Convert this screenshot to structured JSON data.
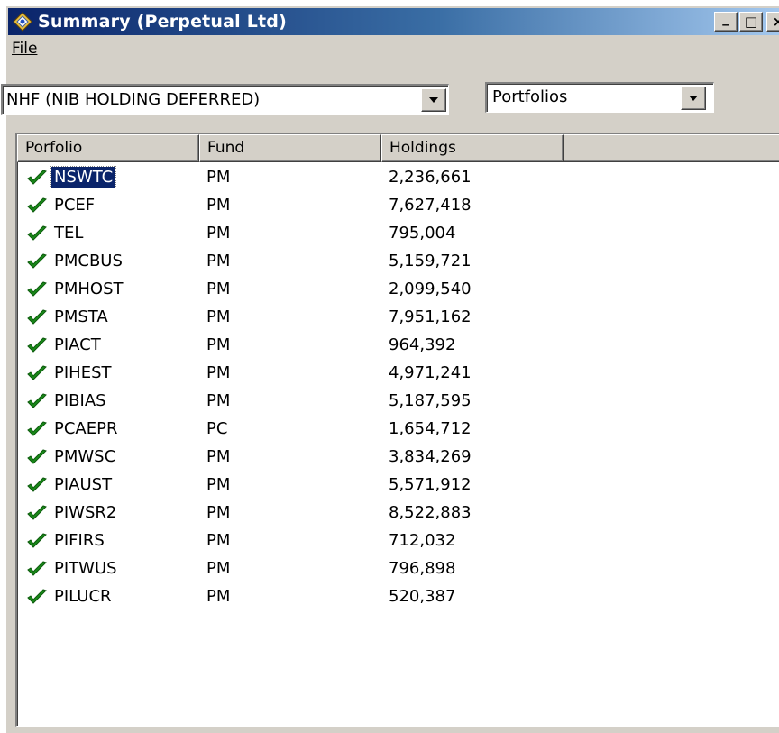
{
  "window": {
    "title": "Summary (Perpetual Ltd)",
    "buttons": {
      "minimize": "_",
      "maximize": "□",
      "close": "×"
    }
  },
  "menu": {
    "file": "File"
  },
  "toolbar": {
    "fund_select": "NHF (NIB HOLDING DEFERRED)",
    "view_select": "Portfolios"
  },
  "table": {
    "columns": [
      "Porfolio",
      "Fund",
      "Holdings",
      ""
    ],
    "rows": [
      {
        "portfolio": "NSWTC",
        "fund": "PM",
        "holdings": "2,236,661",
        "selected": true
      },
      {
        "portfolio": "PCEF",
        "fund": "PM",
        "holdings": "7,627,418"
      },
      {
        "portfolio": "TEL",
        "fund": "PM",
        "holdings": "795,004"
      },
      {
        "portfolio": "PMCBUS",
        "fund": "PM",
        "holdings": "5,159,721"
      },
      {
        "portfolio": "PMHOST",
        "fund": "PM",
        "holdings": "2,099,540"
      },
      {
        "portfolio": "PMSTA",
        "fund": "PM",
        "holdings": "7,951,162"
      },
      {
        "portfolio": "PIACT",
        "fund": "PM",
        "holdings": "964,392"
      },
      {
        "portfolio": "PIHEST",
        "fund": "PM",
        "holdings": "4,971,241"
      },
      {
        "portfolio": "PIBIAS",
        "fund": "PM",
        "holdings": "5,187,595"
      },
      {
        "portfolio": "PCAEPR",
        "fund": "PC",
        "holdings": "1,654,712"
      },
      {
        "portfolio": "PMWSC",
        "fund": "PM",
        "holdings": "3,834,269"
      },
      {
        "portfolio": "PIAUST",
        "fund": "PM",
        "holdings": "5,571,912"
      },
      {
        "portfolio": "PIWSR2",
        "fund": "PM",
        "holdings": "8,522,883"
      },
      {
        "portfolio": "PIFIRS",
        "fund": "PM",
        "holdings": "712,032"
      },
      {
        "portfolio": "PITWUS",
        "fund": "PM",
        "holdings": "796,898"
      },
      {
        "portfolio": "PILUCR",
        "fund": "PM",
        "holdings": "520,387"
      }
    ]
  },
  "icons": {
    "app": "app-icon",
    "row_status": "green-checkmark-icon"
  },
  "colors": {
    "titlebar_start": "#0a246a",
    "titlebar_end": "#a6caf0",
    "check": "#1a8a1a",
    "selection": "#0a246a"
  }
}
